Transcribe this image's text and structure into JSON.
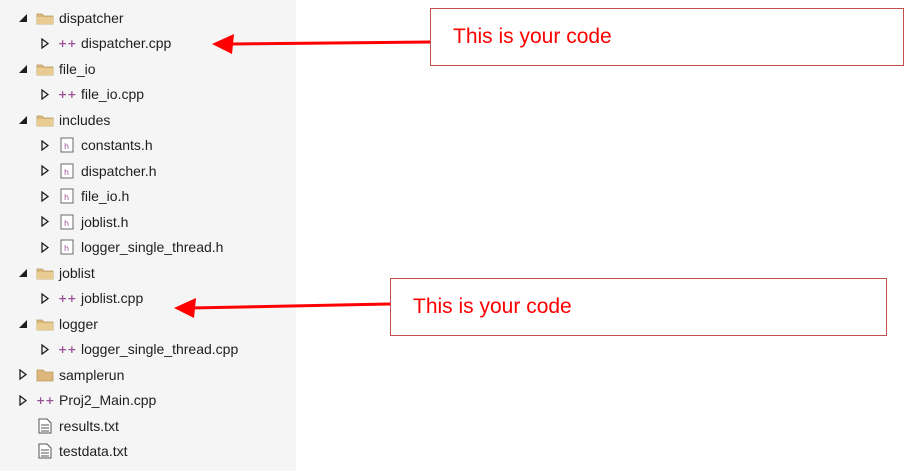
{
  "tree": [
    {
      "label": "dispatcher",
      "type": "folder",
      "expander": "expanded",
      "level": 0
    },
    {
      "label": "dispatcher.cpp",
      "type": "cpp",
      "expander": "collapsed",
      "level": 1
    },
    {
      "label": "file_io",
      "type": "folder",
      "expander": "expanded",
      "level": 0
    },
    {
      "label": "file_io.cpp",
      "type": "cpp",
      "expander": "collapsed",
      "level": 1
    },
    {
      "label": "includes",
      "type": "folder",
      "expander": "expanded",
      "level": 0
    },
    {
      "label": "constants.h",
      "type": "header",
      "expander": "collapsed",
      "level": 1
    },
    {
      "label": "dispatcher.h",
      "type": "header",
      "expander": "collapsed",
      "level": 1
    },
    {
      "label": "file_io.h",
      "type": "header",
      "expander": "collapsed",
      "level": 1
    },
    {
      "label": "joblist.h",
      "type": "header",
      "expander": "collapsed",
      "level": 1
    },
    {
      "label": "logger_single_thread.h",
      "type": "header",
      "expander": "collapsed",
      "level": 1
    },
    {
      "label": "joblist",
      "type": "folder",
      "expander": "expanded",
      "level": 0
    },
    {
      "label": "joblist.cpp",
      "type": "cpp",
      "expander": "collapsed",
      "level": 1
    },
    {
      "label": "logger",
      "type": "folder",
      "expander": "expanded",
      "level": 0
    },
    {
      "label": "logger_single_thread.cpp",
      "type": "cpp",
      "expander": "collapsed",
      "level": 1
    },
    {
      "label": "samplerun",
      "type": "folder-closed",
      "expander": "collapsed",
      "level": 0
    },
    {
      "label": "Proj2_Main.cpp",
      "type": "cpp",
      "expander": "collapsed",
      "level": 0
    },
    {
      "label": "results.txt",
      "type": "text",
      "expander": "none",
      "level": 0
    },
    {
      "label": "testdata.txt",
      "type": "text",
      "expander": "none",
      "level": 0
    }
  ],
  "callouts": [
    {
      "text": "This is your code",
      "target": "dispatcher.cpp"
    },
    {
      "text": "This is your code",
      "target": "joblist.cpp"
    }
  ],
  "colors": {
    "callout_text": "#ff0000",
    "callout_border": "#c0504d",
    "arrow": "#ff0000",
    "folder": "#dcb67a",
    "cpp_icon": "#9b4f96",
    "tree_bg": "#f5f5f5"
  }
}
